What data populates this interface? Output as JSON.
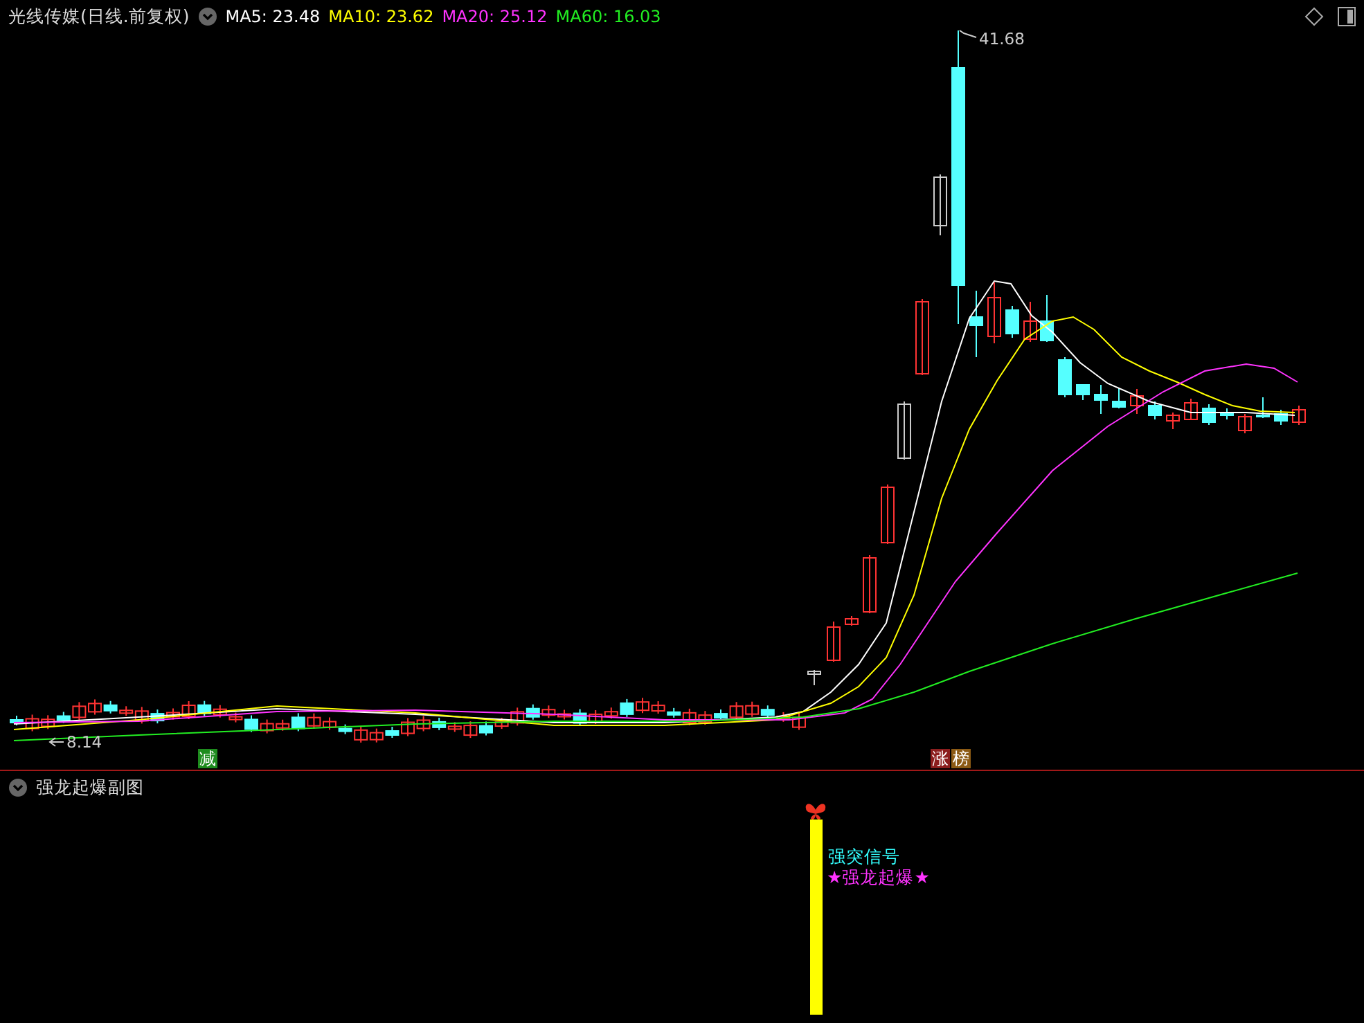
{
  "chart_header": {
    "title": "光线传媒(日线.前复权)",
    "indicators": [
      {
        "label": "MA5: 23.48",
        "color": "#ffffff"
      },
      {
        "label": "MA10: 23.62",
        "color": "#ffff00"
      },
      {
        "label": "MA20: 25.12",
        "color": "#ff33ff"
      },
      {
        "label": "MA60: 16.03",
        "color": "#22ee22"
      }
    ]
  },
  "price_labels": {
    "high": "41.68",
    "low": "8.14"
  },
  "markers": [
    {
      "text": "减",
      "color": "#1e8c1e"
    },
    {
      "text": "涨",
      "color": "#8c1e1e"
    },
    {
      "text": "榜",
      "color": "#8c5a14"
    }
  ],
  "sub_chart": {
    "title": "强龙起爆副图",
    "signals": [
      {
        "text": "强突信号",
        "color": "#33ffff"
      },
      {
        "text": "★强龙起爆★",
        "color": "#ff33ff"
      }
    ]
  }
}
